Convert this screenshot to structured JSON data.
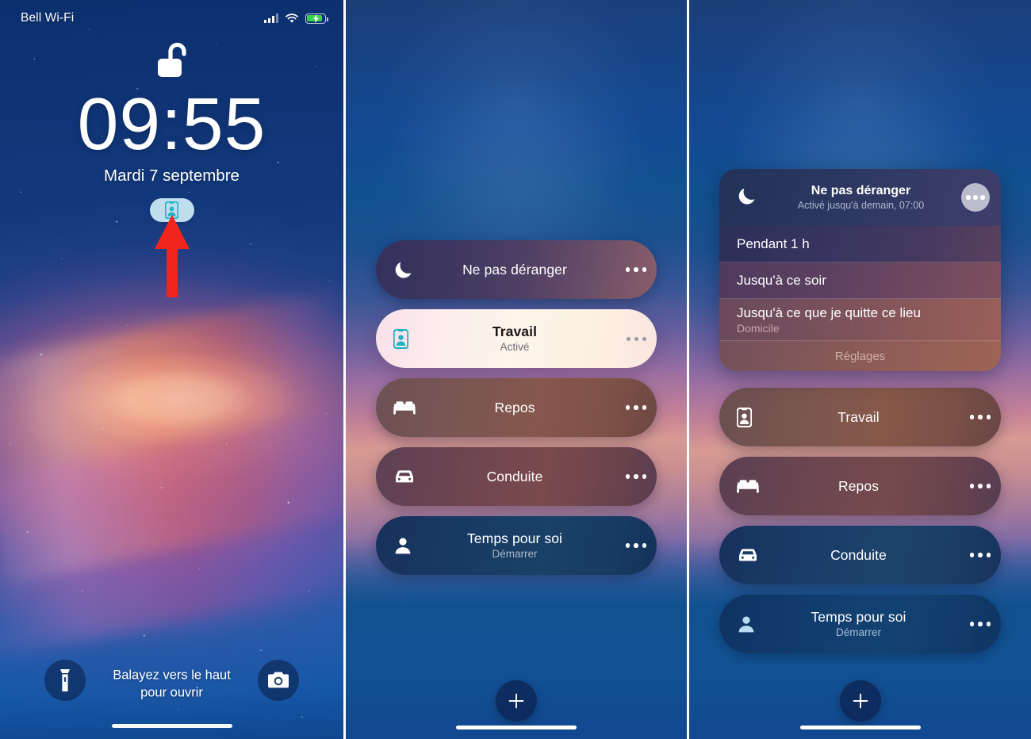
{
  "lock_screen": {
    "status_bar": {
      "carrier": "Bell Wi-Fi",
      "signal_icon": "cellular-signal-icon",
      "wifi_icon": "wifi-icon",
      "battery_icon": "battery-charging-icon"
    },
    "lock_icon": "unlocked-padlock-icon",
    "time": "09:55",
    "date": "Mardi 7 septembre",
    "focus_badge_icon": "work-badge-icon",
    "annotation_arrow": "red-arrow-up-annotation",
    "flashlight_icon": "flashlight-icon",
    "camera_icon": "camera-icon",
    "swipe_hint_line1": "Balayez vers le haut",
    "swipe_hint_line2": "pour ouvrir"
  },
  "focus_list": {
    "rows": [
      {
        "label": "Ne pas déranger",
        "sub": "",
        "icon": "moon-icon",
        "theme": "t-dnd",
        "active": false
      },
      {
        "label": "Travail",
        "sub": "Activé",
        "icon": "badge-icon",
        "theme": "t-work-active",
        "active": true
      },
      {
        "label": "Repos",
        "sub": "",
        "icon": "bed-icon",
        "theme": "t-rest",
        "active": false
      },
      {
        "label": "Conduite",
        "sub": "",
        "icon": "car-icon",
        "theme": "t-drive",
        "active": false
      },
      {
        "label": "Temps pour soi",
        "sub": "Démarrer",
        "icon": "person-icon",
        "theme": "t-pers",
        "active": false
      }
    ],
    "more_icon": "ellipsis-icon",
    "add_label": "+",
    "add_icon": "plus-icon"
  },
  "focus_expanded": {
    "dnd_card": {
      "icon": "moon-icon",
      "title": "Ne pas déranger",
      "subtitle": "Activé jusqu'à demain, 07:00",
      "more_icon": "ellipsis-icon",
      "options": [
        {
          "title": "Pendant 1 h",
          "sub": ""
        },
        {
          "title": "Jusqu'à ce soir",
          "sub": ""
        },
        {
          "title": "Jusqu'à ce que je quitte ce lieu",
          "sub": "Domicile"
        }
      ],
      "settings_label": "Réglages"
    },
    "rows": [
      {
        "label": "Travail",
        "sub": "",
        "icon": "badge-icon",
        "theme": "t-work-r"
      },
      {
        "label": "Repos",
        "sub": "",
        "icon": "bed-icon",
        "theme": "t-rest-r"
      },
      {
        "label": "Conduite",
        "sub": "",
        "icon": "car-icon",
        "theme": "t-drive-r"
      },
      {
        "label": "Temps pour soi",
        "sub": "Démarrer",
        "icon": "person-icon",
        "theme": "t-pers-r"
      }
    ],
    "add_icon": "plus-icon"
  },
  "colors": {
    "accent_teal": "#1fb4c4",
    "annotation_red": "#f2251c",
    "battery_green": "#3ad14f",
    "active_pill": "#fdf2ea"
  }
}
